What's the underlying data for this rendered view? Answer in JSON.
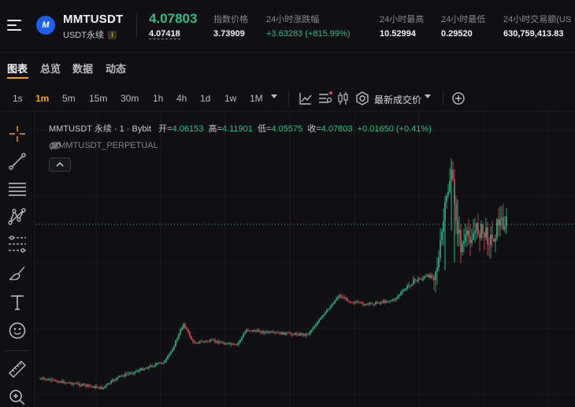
{
  "header": {
    "symbol": "MMTUSDT",
    "subsymbol": "USDT永续",
    "info_badge": "i",
    "last_price": "4.07803",
    "mark_price": "4.07418",
    "stats": [
      {
        "label": "指数价格",
        "value": "3.73909",
        "tone": "neutral"
      },
      {
        "label": "24小时涨跌幅",
        "value": "+3.63283 (+815.99%)",
        "tone": "green"
      },
      {
        "label": "24小时最高",
        "value": "10.52994",
        "tone": "neutral"
      },
      {
        "label": "24小时最低",
        "value": "0.29520",
        "tone": "neutral"
      },
      {
        "label": "24小时交易额(US",
        "value": "630,759,413.83",
        "tone": "neutral"
      }
    ]
  },
  "tabs": [
    "图表",
    "总览",
    "数据",
    "动态"
  ],
  "active_tab": "图表",
  "toolbar": {
    "timeframes": [
      "1s",
      "1m",
      "5m",
      "15m",
      "30m",
      "1h",
      "4h",
      "1d",
      "1w",
      "1M"
    ],
    "active_timeframe": "1m",
    "price_type": "最新成交价"
  },
  "legend": {
    "title": "MMTUSDT 永续 · 1 · Bybit",
    "open_label": "开=",
    "open": "4.06153",
    "high_label": "高=",
    "high": "4.11901",
    "low_label": "低=",
    "low": "4.05575",
    "close_label": "收=",
    "close": "4.07803",
    "change": "+0.01650 (+0.41%)",
    "secondary": ".MMMTUSDT_PERPETUAL"
  },
  "colors": {
    "up": "#2fbd85",
    "down": "#e34a59",
    "accent": "#f7a600",
    "background": "#101014"
  },
  "icons": {
    "tools": [
      "crosshair-icon",
      "trendline-icon",
      "fib-lines-icon",
      "pattern-icon",
      "measure-lines-icon",
      "brush-icon",
      "text-icon",
      "emoji-icon",
      "ruler-icon",
      "zoom-in-icon"
    ]
  }
}
